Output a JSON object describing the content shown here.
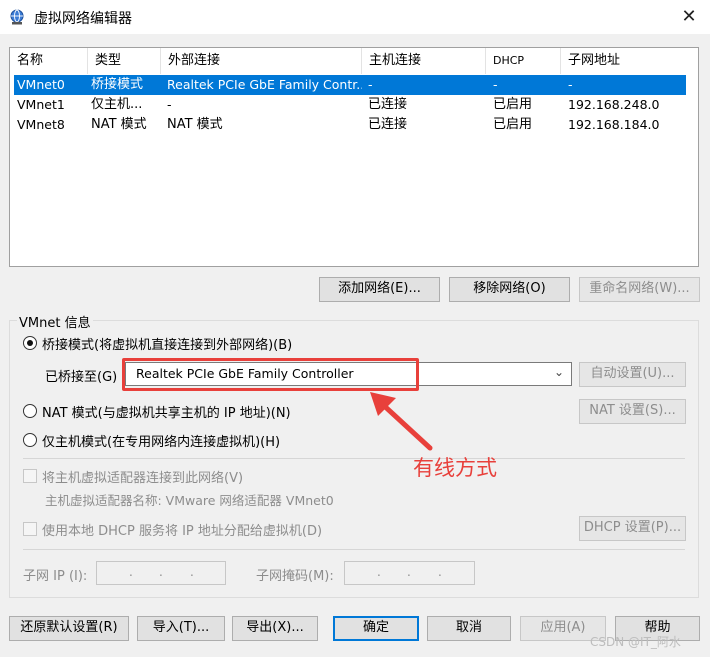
{
  "window": {
    "title": "虚拟网络编辑器",
    "close_glyph": "✕"
  },
  "network_table": {
    "columns": [
      "名称",
      "类型",
      "外部连接",
      "主机连接",
      "DHCP",
      "子网地址"
    ],
    "rows": [
      {
        "name": "VMnet0",
        "type": "桥接模式",
        "external": "Realtek PCIe GbE Family Contr...",
        "host": "-",
        "dhcp": "-",
        "subnet": "-",
        "selected": true
      },
      {
        "name": "VMnet1",
        "type": "仅主机...",
        "external": "-",
        "host": "已连接",
        "dhcp": "已启用",
        "subnet": "192.168.248.0",
        "selected": false
      },
      {
        "name": "VMnet8",
        "type": "NAT 模式",
        "external": "NAT 模式",
        "host": "已连接",
        "dhcp": "已启用",
        "subnet": "192.168.184.0",
        "selected": false
      }
    ]
  },
  "network_buttons": {
    "add": "添加网络(E)...",
    "remove": "移除网络(O)",
    "rename": "重命名网络(W)..."
  },
  "vmnet_info": {
    "legend": "VMnet 信息",
    "bridged_label": "桥接模式(将虚拟机直接连接到外部网络)(B)",
    "bridged_to_label": "已桥接至(G)",
    "bridged_to_value": "Realtek PCIe GbE Family Controller",
    "auto_settings": "自动设置(U)...",
    "nat_label": "NAT 模式(与虚拟机共享主机的 IP 地址)(N)",
    "nat_settings": "NAT 设置(S)...",
    "hostonly_label": "仅主机模式(在专用网络内连接虚拟机)(H)",
    "connect_adapter_label": "将主机虚拟适配器连接到此网络(V)",
    "adapter_name_label": "主机虚拟适配器名称: VMware 网络适配器 VMnet0",
    "dhcp_label": "使用本地 DHCP 服务将 IP 地址分配给虚拟机(D)",
    "dhcp_settings": "DHCP 设置(P)...",
    "subnet_ip_label": "子网 IP (I):",
    "subnet_mask_label": "子网掩码(M):",
    "ip_dot": "."
  },
  "annotation": {
    "text": "有线方式",
    "color": "#e8403b"
  },
  "footer_buttons": {
    "restore": "还原默认设置(R)",
    "import": "导入(T)...",
    "export": "导出(X)...",
    "ok": "确定",
    "cancel": "取消",
    "apply": "应用(A)",
    "help": "帮助"
  },
  "watermark": "CSDN @IT_阿水",
  "colors": {
    "selection": "#0078d7",
    "highlight_box": "#e8403b"
  }
}
